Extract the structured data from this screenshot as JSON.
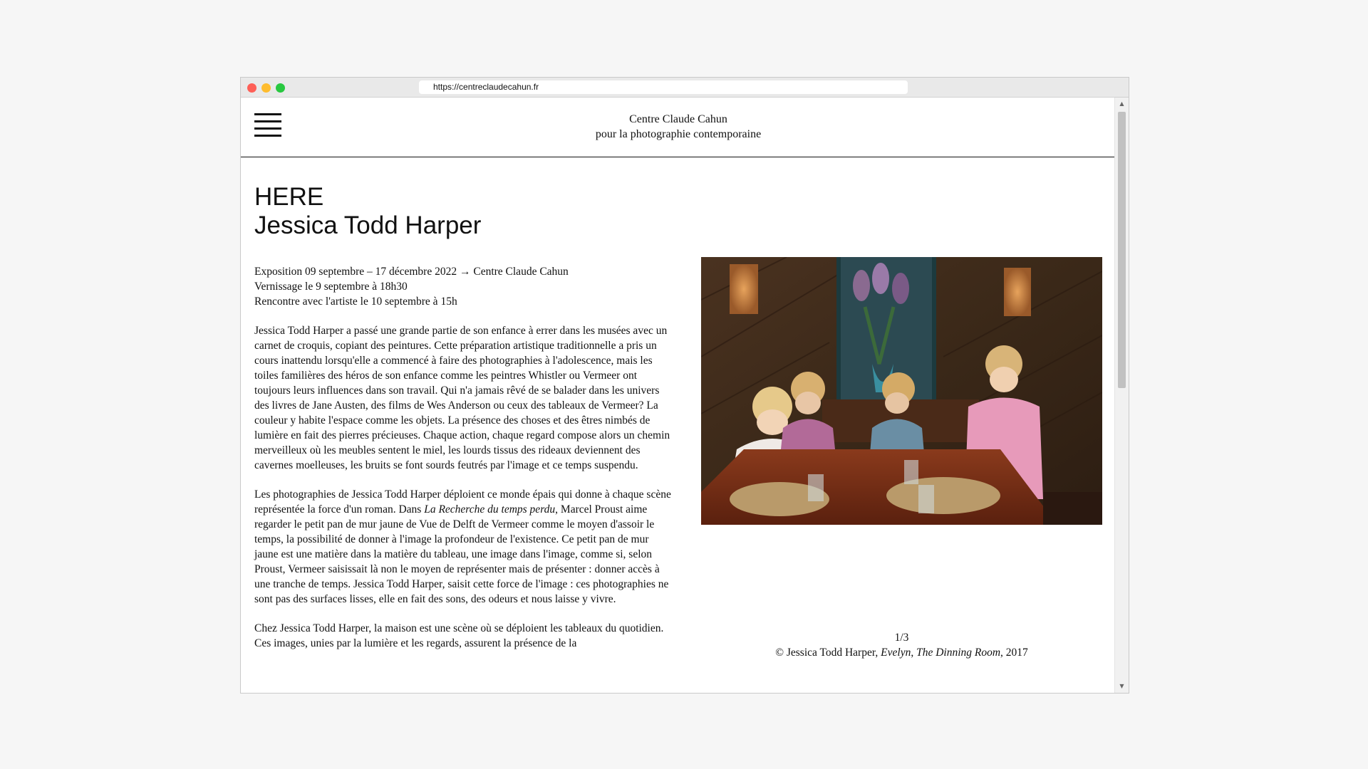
{
  "browser": {
    "url": "https://centreclaudecahun.fr"
  },
  "site": {
    "title_line1": "Centre Claude Cahun",
    "title_line2": "pour la photographie contemporaine"
  },
  "exhibition": {
    "title": "HERE",
    "artist": "Jessica Todd Harper",
    "dates": "Exposition 09 septembre – 17 décembre 2022 → Centre Claude Cahun",
    "opening": "Vernissage le 9 septembre à 18h30",
    "meeting": "Rencontre avec l'artiste le 10 septembre à 15h"
  },
  "body": {
    "para1": "Jessica Todd Harper a passé une grande partie de son enfance à errer dans les musées avec un carnet de croquis, copiant des peintures. Cette préparation artistique traditionnelle a pris un cours inattendu lorsqu'elle a commencé à faire des photographies à l'adolescence, mais les toiles familières des héros de son enfance comme les peintres Whistler ou Vermeer ont toujours leurs influences dans son travail. Qui n'a jamais rêvé de se balader dans les univers des livres de Jane Austen, des films de Wes Anderson ou ceux des tableaux de Vermeer? La couleur y habite l'espace comme les objets. La présence des choses et des êtres nimbés de lumière en fait des pierres précieuses. Chaque action, chaque regard compose alors un chemin merveilleux où les meubles sentent le miel, les lourds tissus des rideaux deviennent des cavernes moelleuses, les bruits se font sourds feutrés par l'image et ce temps suspendu.",
    "para2_before": "Les photographies de Jessica Todd Harper déploient ce monde épais qui donne à chaque scène représentée la force d'un roman. Dans ",
    "para2_italic": "La Recherche du temps perdu",
    "para2_after": ", Marcel Proust aime regarder le petit pan de mur jaune de Vue de Delft de Vermeer comme le moyen d'assoir le temps, la possibilité de donner à l'image la profondeur de l'existence. Ce petit pan de mur jaune est une matière dans la matière du tableau, une image dans l'image, comme si, selon Proust, Vermeer saisissait là non le moyen de représenter mais de présenter : donner accès à une tranche de temps. Jessica Todd Harper, saisit cette force de l'image : ces photographies ne sont pas des surfaces lisses, elle en fait des sons, des odeurs et nous laisse y vivre.",
    "para3": "Chez Jessica Todd Harper, la maison est une scène où se déploient les tableaux du quotidien. Ces images, unies par la lumière et les regards, assurent la présence de la"
  },
  "gallery": {
    "counter": "1/3",
    "caption_prefix": "© Jessica Todd Harper, ",
    "caption_title1": "Evelyn",
    "caption_sep": ", ",
    "caption_title2": "The Dinning Room",
    "caption_suffix": ", 2017"
  },
  "colors": {
    "window_red": "#fe5f57",
    "window_yellow": "#febc2e",
    "window_green": "#28c840",
    "text": "#111111"
  }
}
